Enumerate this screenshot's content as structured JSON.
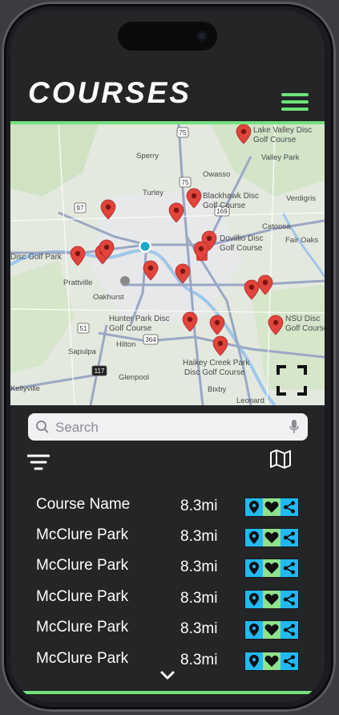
{
  "header": {
    "title": "COURSES"
  },
  "map": {
    "place_labels": [
      {
        "text": "Lake Valley Disc",
        "text2": "Golf Course"
      },
      {
        "text": "Sperry"
      },
      {
        "text": "Owasso"
      },
      {
        "text": "Valley Park"
      },
      {
        "text": "Turley"
      },
      {
        "text": "Blackhawk Disc",
        "text2": "Golf Course"
      },
      {
        "text": "Verdigris"
      },
      {
        "text": "Catoosa"
      },
      {
        "text": "Dovillio Disc",
        "text2": "Golf Course"
      },
      {
        "text": "Fair Oaks"
      },
      {
        "text": "Disc Golf Park"
      },
      {
        "text": "Prattville"
      },
      {
        "text": "Oakhurst"
      },
      {
        "text": "Hunter Park Disc",
        "text2": "Golf Course"
      },
      {
        "text": "NSU Disc",
        "text2": "Golf Course"
      },
      {
        "text": "Hilton"
      },
      {
        "text": "Sapulpa"
      },
      {
        "text": "Haikey Creek Park",
        "text2": "Disc Golf Course"
      },
      {
        "text": "Glenpool"
      },
      {
        "text": "Kellyville"
      },
      {
        "text": "Bixby"
      },
      {
        "text": "Leonard"
      }
    ],
    "route_shields": [
      "75",
      "97",
      "169",
      "75",
      "51",
      "364",
      "117"
    ]
  },
  "search": {
    "placeholder": "Search"
  },
  "list": {
    "rows": [
      {
        "name": "Course Name",
        "distance": "8.3mi"
      },
      {
        "name": "McClure Park",
        "distance": "8.3mi"
      },
      {
        "name": "McClure Park",
        "distance": "8.3mi"
      },
      {
        "name": "McClure Park",
        "distance": "8.3mi"
      },
      {
        "name": "McClure Park",
        "distance": "8.3mi"
      },
      {
        "name": "McClure Park",
        "distance": "8.3mi"
      }
    ]
  },
  "colors": {
    "accent": "#76e07f",
    "action_blue": "#22b8f0",
    "action_green": "#8fe28a",
    "pin": "#e0443c"
  },
  "icons": [
    "menu-icon",
    "fullscreen-icon",
    "search-icon",
    "mic-icon",
    "filter-icon",
    "map-icon",
    "pin-icon",
    "heart-icon",
    "share-icon",
    "chevron-down-icon"
  ]
}
